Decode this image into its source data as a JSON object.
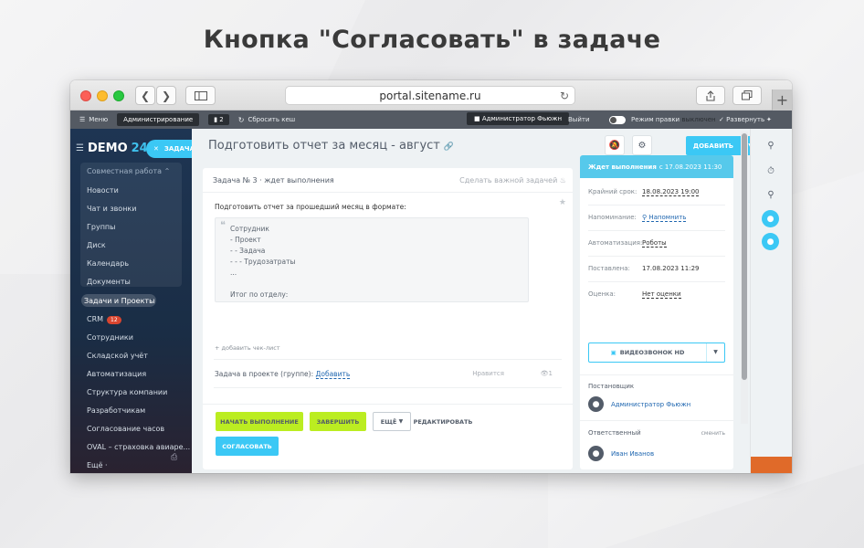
{
  "headline": "Кнопка \"Согласовать\" в задаче",
  "browser": {
    "url": "portal.sitename.ru",
    "new_tab": "+"
  },
  "admin_bar": {
    "menu": "Меню",
    "administration": "Администрирование",
    "badge_count": "2",
    "clear_cache": "Сбросить кеш",
    "user": "Администратор Фьюжн",
    "logout": "Выйти",
    "rights_mode": "Режим правки",
    "rights_state": "выключен",
    "expand": "Развернуть"
  },
  "sidebar": {
    "logo": "DEMO",
    "logo_num": "24",
    "task_button": "ЗАДАЧА",
    "group_title": "Совместная работа",
    "items": [
      "Новости",
      "Чат и звонки",
      "Группы",
      "Диск",
      "Календарь",
      "Документы",
      "Задачи и Проекты",
      "CRM",
      "Сотрудники",
      "Складской учёт",
      "Автоматизация",
      "Структура компании",
      "Разработчикам",
      "Согласование часов",
      "OVAL – страховка авиаре...",
      "Ещё ·"
    ],
    "crm_badge": "12"
  },
  "page": {
    "title": "Подготовить отчет за месяц - август",
    "add_button": "ДОБАВИТЬ"
  },
  "task": {
    "header_left": "Задача № 3 · ждет выполнения",
    "header_right": "Сделать важной задачей",
    "description": "Подготовить  отчет за прошедший месяц  в формате:",
    "quote_lines": [
      "Сотрудник",
      "- Проект",
      "- - Задача",
      "- - - Трудозатраты",
      "...",
      "",
      "Итог по отделу:"
    ],
    "checklist_link": "+ добавить чек-лист",
    "project_label": "Задача в проекте (группе):",
    "project_value": "Добавить",
    "likes": "Нравится",
    "views": "1",
    "buttons": {
      "start": "НАЧАТЬ ВЫПОЛНЕНИЕ",
      "finish": "ЗАВЕРШИТЬ",
      "more": "ЕЩЁ",
      "edit": "РЕДАКТИРОВАТЬ",
      "approve": "СОГЛАСОВАТЬ"
    }
  },
  "side": {
    "status": "Ждет выполнения",
    "status_date": "с 17.08.2023 11:30",
    "deadline_label": "Крайний срок:",
    "deadline_value": "18.08.2023 19:00",
    "reminder_label": "Напоминание:",
    "reminder_value": "Напомнить",
    "automation_label": "Автоматизация:",
    "automation_value": "Роботы",
    "created_label": "Поставлена:",
    "created_value": "17.08.2023 11:29",
    "rating_label": "Оценка:",
    "rating_value": "Нет оценки",
    "video_button": "ВИДЕОЗВОНОК HD",
    "creator_title": "Постановщик",
    "creator_name": "Администратор Фьюжн",
    "responsible_title": "Ответственный",
    "responsible_change": "сменить",
    "responsible_name": "Иван Иванов"
  },
  "colors": {
    "accent": "#3bc8f5",
    "green_button": "#bbed21",
    "sidebar_bg": "#1e3553",
    "status_header": "#56c9eb"
  }
}
